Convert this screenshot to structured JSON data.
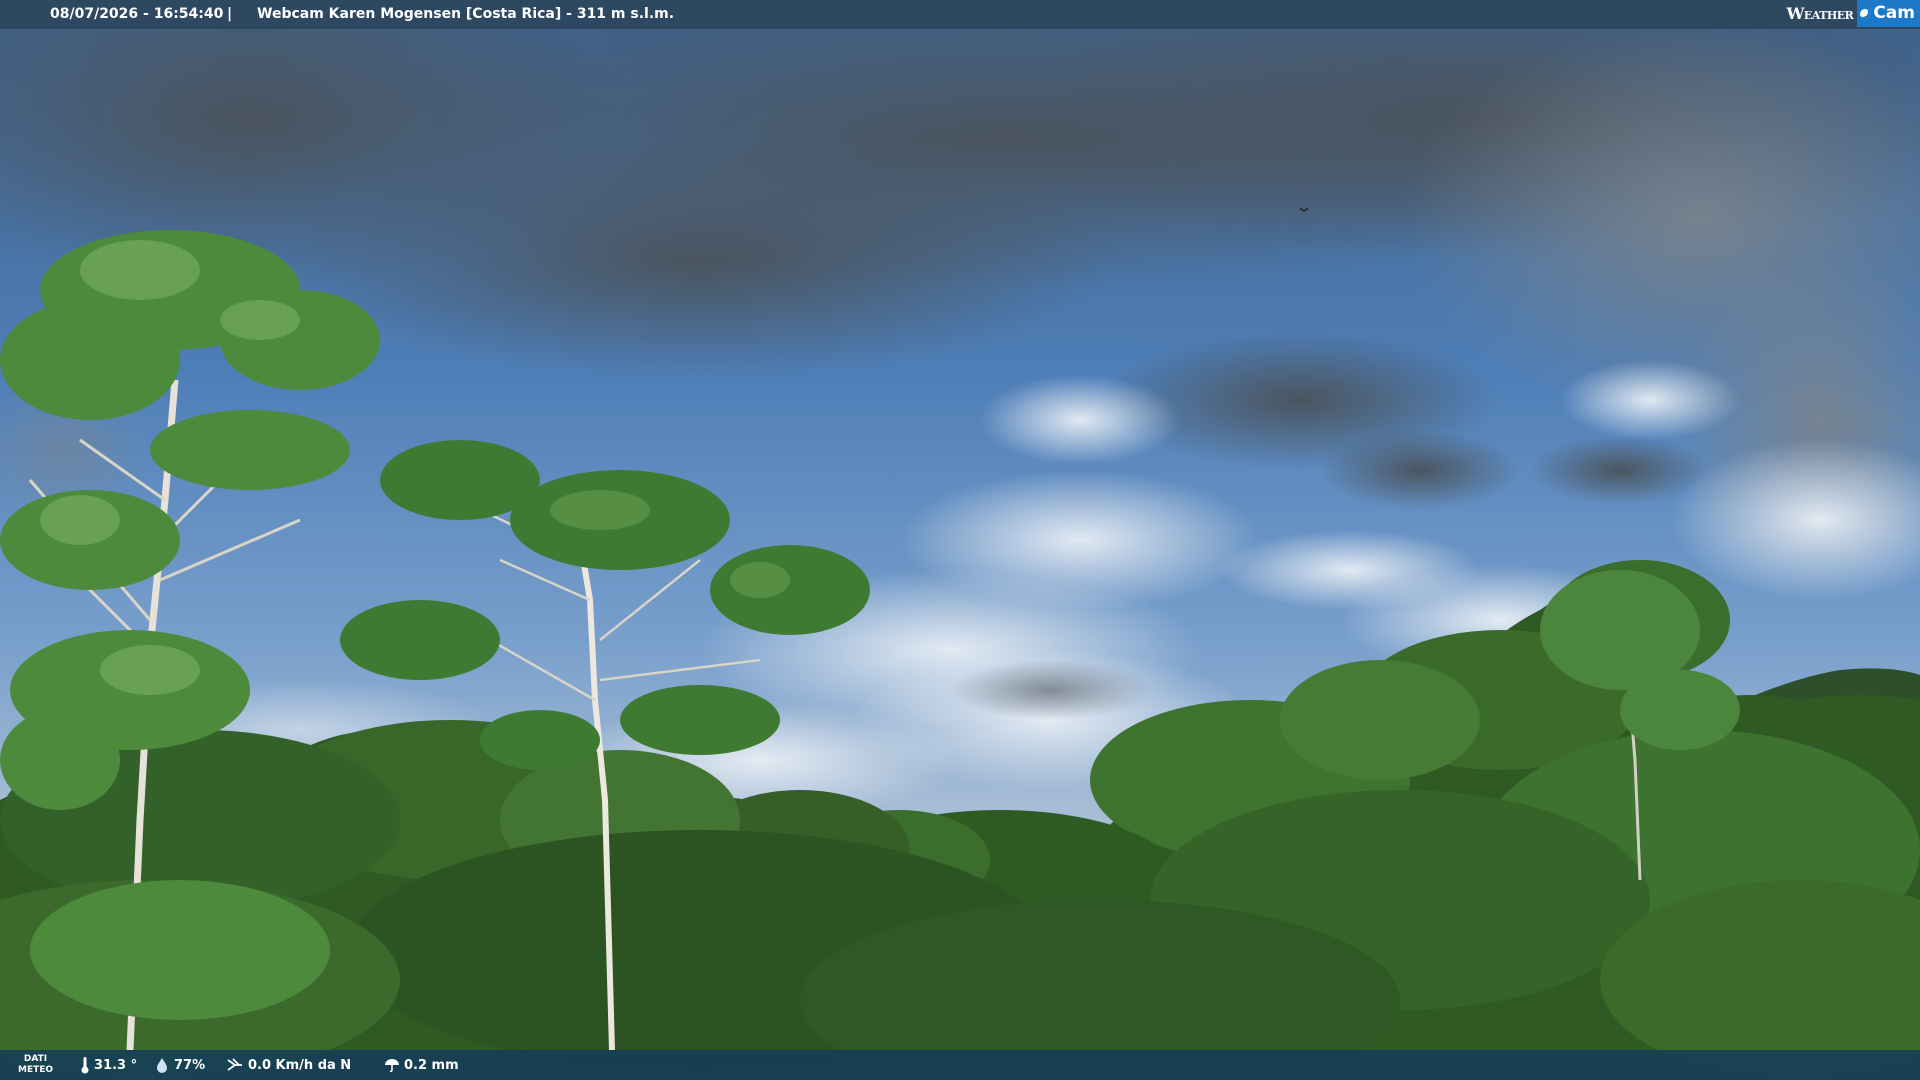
{
  "header": {
    "datetime": "08/07/2026 - 16:54:40",
    "separator": "|",
    "title": "Webcam Karen Mogensen [Costa Rica]  - 311 m s.l.m."
  },
  "logo": {
    "part1": "Weather",
    "part2": "Cam",
    "accent_color": "#1c79c7"
  },
  "footer": {
    "label_line1": "DATI",
    "label_line2": "METEO",
    "temperature": "31.3 °",
    "temperature_icon": "thermometer-icon",
    "humidity": "77%",
    "humidity_icon": "droplet-icon",
    "wind": "0.0 Km/h da N",
    "wind_icon": "wind-icon",
    "rain": "0.2 mm",
    "rain_icon": "umbrella-icon"
  },
  "colors": {
    "sky_top": "#4a6f9a",
    "sky_mid": "#5a8bc4",
    "cloud_dark": "#5b6670",
    "foliage": "#3d6b2a",
    "bar_bg": "#2c4660"
  }
}
